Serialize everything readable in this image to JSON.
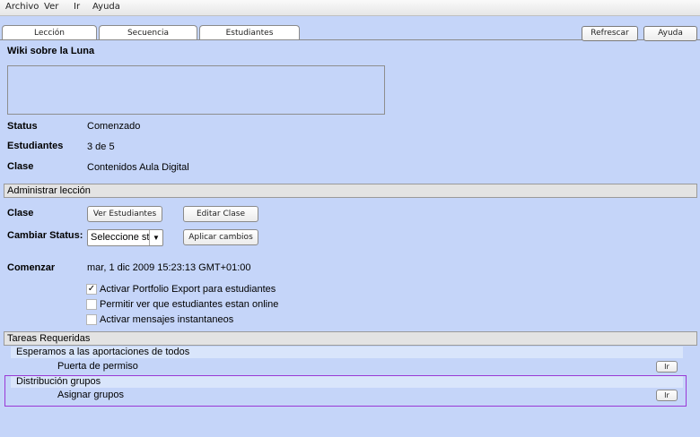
{
  "menu": [
    "Archivo",
    "Ver",
    "Ir",
    "Ayuda"
  ],
  "tabs": [
    "Lección",
    "Secuencia",
    "Estudiantes"
  ],
  "toolbar": {
    "refresh": "Refrescar",
    "help": "Ayuda"
  },
  "lesson": {
    "title": "Wiki sobre la Luna",
    "status_label": "Status",
    "status_value": "Comenzado",
    "students_label": "Estudiantes",
    "students_value": "3 de 5",
    "class_label": "Clase",
    "class_value": "Contenidos Aula Digital"
  },
  "admin": {
    "header": "Administrar lección",
    "class_label": "Clase",
    "view_students": "Ver Estudiantes",
    "edit_class": "Editar Clase",
    "change_status_label": "Cambiar Status:",
    "status_select": "Seleccione st",
    "apply": "Aplicar cambios",
    "start_label": "Comenzar",
    "start_value": "mar, 1 dic 2009 15:23:13 GMT+01:00",
    "options": [
      {
        "label": "Activar Portfolio Export para estudiantes",
        "checked": true
      },
      {
        "label": "Permitir ver que estudiantes estan online",
        "checked": false
      },
      {
        "label": "Activar mensajes instantaneos",
        "checked": false
      }
    ]
  },
  "tasks": {
    "header": "Tareas Requeridas",
    "groups": [
      {
        "title": "Esperamos a las aportaciones de todos",
        "task": "Puerta de permiso",
        "button": "Ir"
      },
      {
        "title": "Distribución grupos",
        "task": "Asignar grupos",
        "button": "Ir"
      }
    ]
  }
}
